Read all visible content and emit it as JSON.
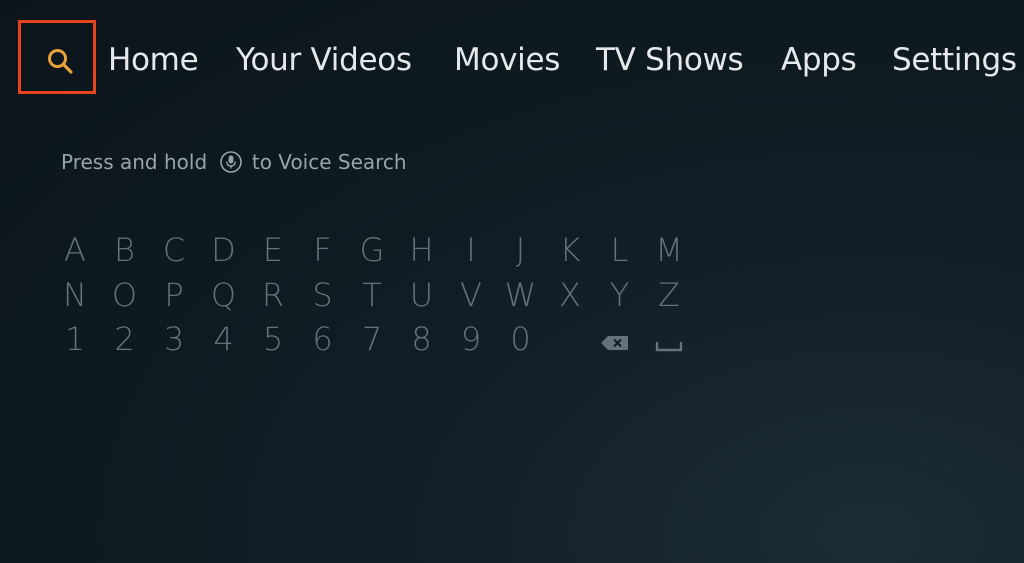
{
  "nav": {
    "search_icon": "search-icon",
    "items": [
      {
        "label": "Home"
      },
      {
        "label": "Your Videos"
      },
      {
        "label": "Movies"
      },
      {
        "label": "TV Shows"
      },
      {
        "label": "Apps"
      },
      {
        "label": "Settings"
      }
    ]
  },
  "voice_hint": {
    "before": "Press and hold",
    "icon": "microphone-icon",
    "after": "to Voice Search"
  },
  "keyboard": {
    "rows": [
      [
        "A",
        "B",
        "C",
        "D",
        "E",
        "F",
        "G",
        "H",
        "I",
        "J",
        "K",
        "L",
        "M"
      ],
      [
        "N",
        "O",
        "P",
        "Q",
        "R",
        "S",
        "T",
        "U",
        "V",
        "W",
        "X",
        "Y",
        "Z"
      ],
      [
        "1",
        "2",
        "3",
        "4",
        "5",
        "6",
        "7",
        "8",
        "9",
        "0"
      ]
    ],
    "special_keys": [
      "backspace-icon",
      "space-icon"
    ]
  },
  "colors": {
    "focus_outline": "#e8451e",
    "search_icon": "#e8a33a",
    "nav_text": "#e6e9ec",
    "hint_text": "#98a3ab",
    "key_text": "#66717a",
    "background": "#0f1a21"
  }
}
